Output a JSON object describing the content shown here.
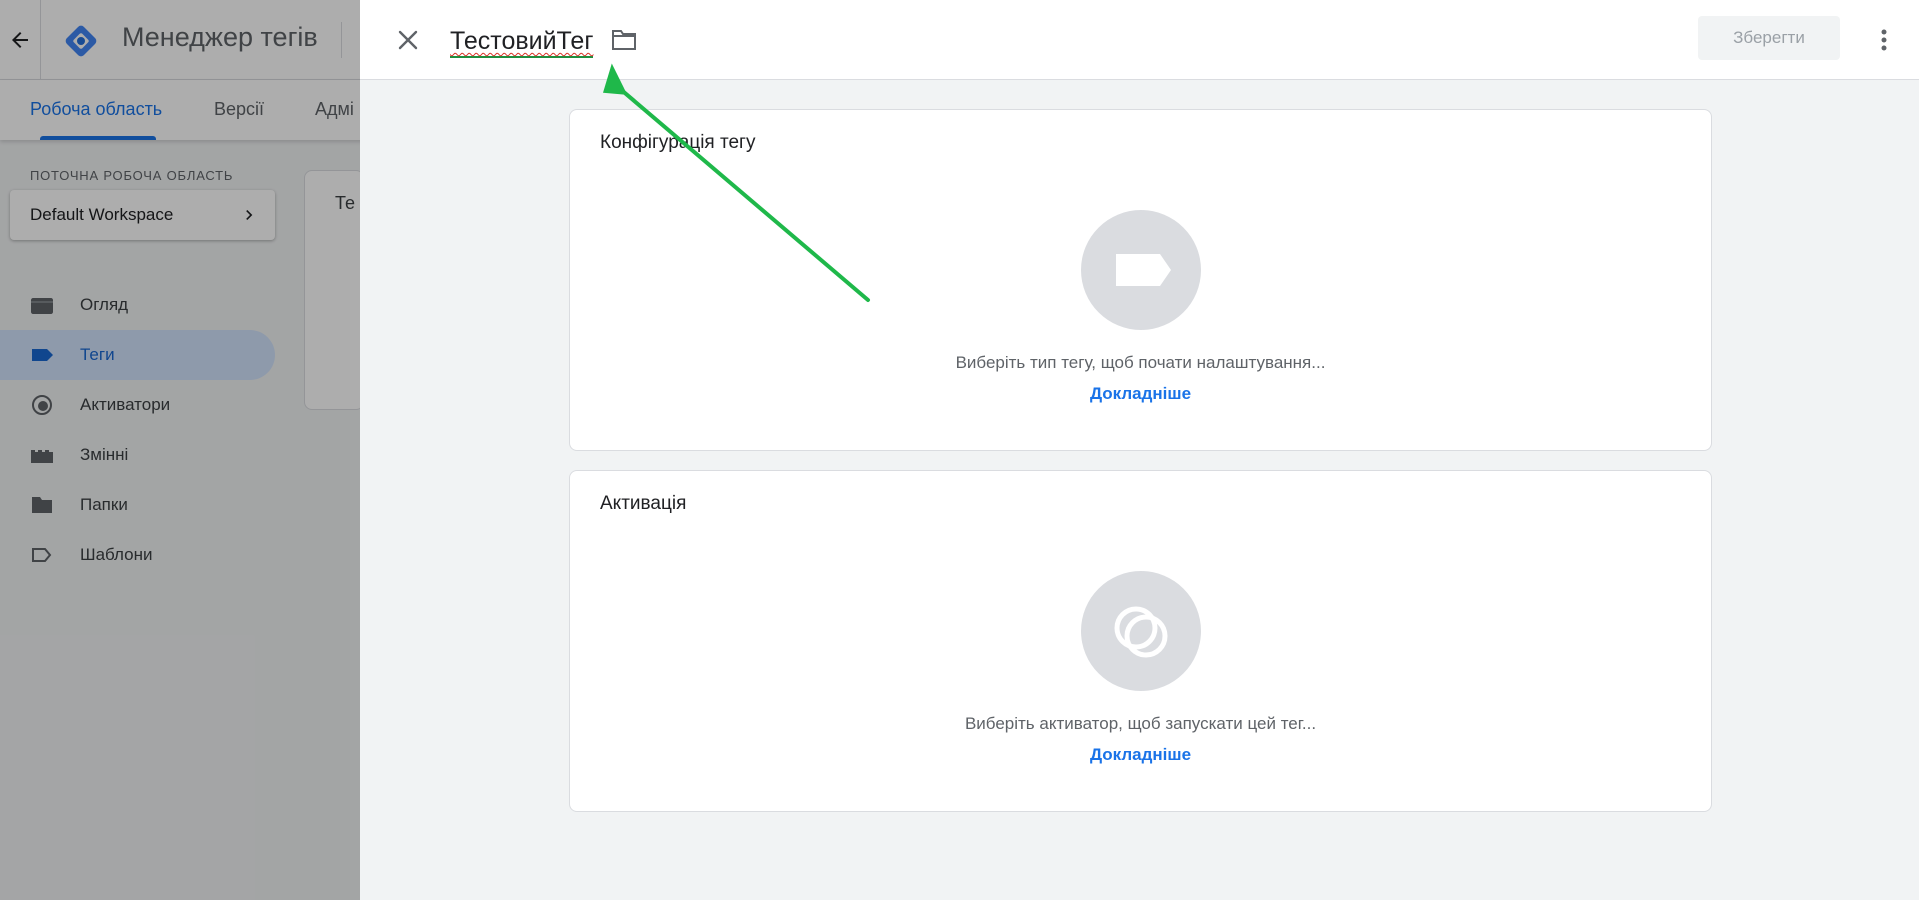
{
  "app": {
    "title": "Менеджер тегів",
    "tabs": [
      {
        "label": "Робоча область"
      },
      {
        "label": "Версії"
      },
      {
        "label": "Адмі"
      }
    ],
    "workspace_label": "ПОТОЧНА РОБОЧА ОБЛАСТЬ",
    "workspace_name": "Default Workspace",
    "nav": [
      {
        "label": "Огляд",
        "icon": "overview-icon"
      },
      {
        "label": "Теги",
        "icon": "tag-icon"
      },
      {
        "label": "Активатори",
        "icon": "trigger-icon"
      },
      {
        "label": "Змінні",
        "icon": "variables-icon"
      },
      {
        "label": "Папки",
        "icon": "folder-icon"
      },
      {
        "label": "Шаблони",
        "icon": "template-icon"
      }
    ],
    "card_partial_title": "Те"
  },
  "panel": {
    "tag_name": "ТестовийТег",
    "save_label": "Зберегти",
    "tag_config": {
      "title": "Конфігурація тегу",
      "hint": "Виберіть тип тегу, щоб почати налаштування...",
      "link": "Докладніше"
    },
    "triggering": {
      "title": "Активація",
      "hint": "Виберіть активатор, щоб запускати цей тег...",
      "link": "Докладніше"
    }
  },
  "colors": {
    "accent": "#1a73e8",
    "annotation_arrow": "#1fb84a"
  }
}
